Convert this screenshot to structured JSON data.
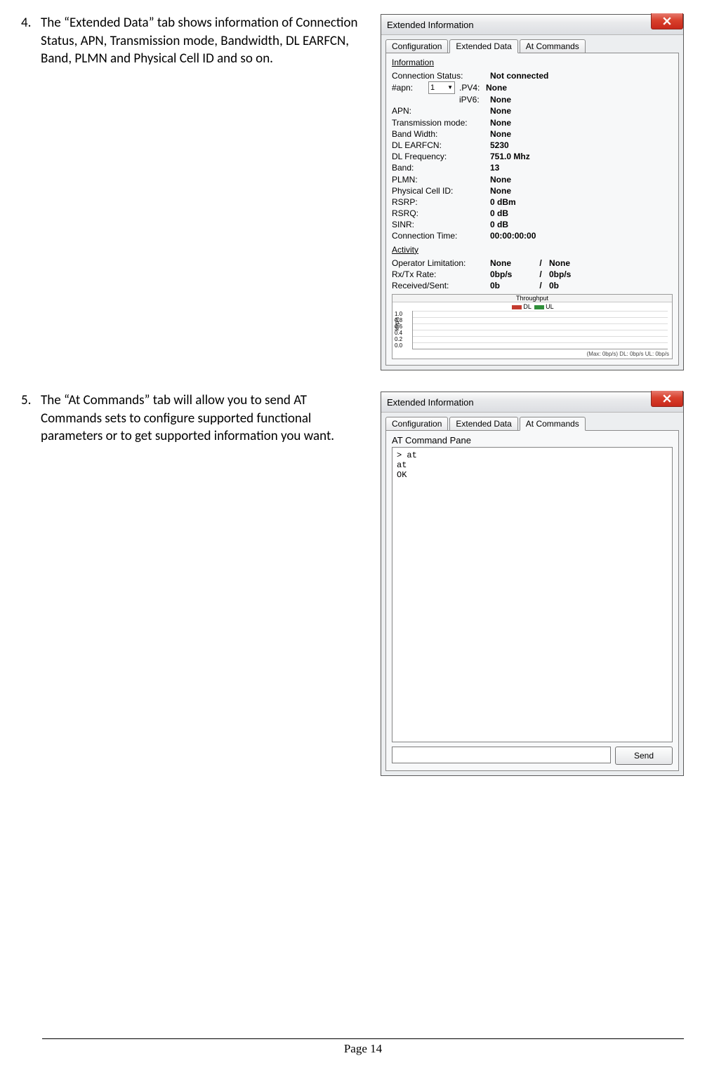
{
  "items": [
    {
      "num": "4.",
      "desc": "The “Extended Data” tab shows information of Connection Status, APN, Transmission mode, Bandwidth, DL EARFCN, Band, PLMN and Physical Cell ID and so on."
    },
    {
      "num": "5.",
      "desc": "The “At Commands” tab will allow you to send AT Commands sets to configure supported functional parameters or to get supported information you want."
    }
  ],
  "win1": {
    "title": "Extended Information",
    "tabs": [
      "Configuration",
      "Extended Data",
      "At Commands"
    ],
    "active_tab": 1,
    "group_info": "Information",
    "info": {
      "conn_status_k": "Connection Status:",
      "conn_status_v": "Not connected",
      "apn_num_k": "#apn:",
      "apn_num_v": "1",
      "pv4_k": ".PV4:",
      "pv4_v": "None",
      "pv6_k": "iPV6:",
      "pv6_v": "None",
      "apn_k": "APN:",
      "apn_v": "None",
      "tx_k": "Transmission mode:",
      "tx_v": "None",
      "bw_k": "Band Width:",
      "bw_v": "None",
      "earfcn_k": "DL EARFCN:",
      "earfcn_v": "5230",
      "dlf_k": "DL Frequency:",
      "dlf_v": "751.0 Mhz",
      "band_k": "Band:",
      "band_v": "13",
      "plmn_k": "PLMN:",
      "plmn_v": "None",
      "pci_k": "Physical Cell ID:",
      "pci_v": "None",
      "rsrp_k": "RSRP:",
      "rsrp_v": "0 dBm",
      "rsrq_k": "RSRQ:",
      "rsrq_v": "0 dB",
      "sinr_k": "SINR:",
      "sinr_v": "0 dB",
      "ct_k": "Connection Time:",
      "ct_v": "00:00:00:00"
    },
    "group_act": "Activity",
    "act": {
      "op_k": "Operator Limitation:",
      "op_a": "None",
      "op_b": "None",
      "rate_k": "Rx/Tx Rate:",
      "rate_a": "0bp/s",
      "rate_b": "0bp/s",
      "rs_k": "Received/Sent:",
      "rs_a": "0b",
      "rs_b": "0b",
      "sep": "/"
    },
    "chart": {
      "title": "Throughput",
      "legend_dl": "DL",
      "legend_ul": "UL",
      "yticks": "1.0\n0.8\n0.6\n0.4\n0.2\n0.0",
      "yunit": "kbp/s",
      "foot": "(Max: 0bp/s) DL: 0bp/s UL: 0bp/s"
    }
  },
  "win2": {
    "title": "Extended Information",
    "tabs": [
      "Configuration",
      "Extended Data",
      "At Commands"
    ],
    "active_tab": 2,
    "pane_title": "AT Command Pane",
    "output": "> at\nat\nOK",
    "input": "",
    "send": "Send"
  },
  "footer": "Page 14",
  "chart_data": {
    "type": "line",
    "title": "Throughput",
    "ylabel": "kbp/s",
    "ylim": [
      0,
      1.0
    ],
    "yticks": [
      0.0,
      0.2,
      0.4,
      0.6,
      0.8,
      1.0
    ],
    "series": [
      {
        "name": "DL",
        "values": [
          0,
          0,
          0,
          0,
          0,
          0,
          0,
          0,
          0,
          0
        ]
      },
      {
        "name": "UL",
        "values": [
          0,
          0,
          0,
          0,
          0,
          0,
          0,
          0,
          0,
          0
        ]
      }
    ],
    "annotation": "(Max: 0bp/s) DL: 0bp/s UL: 0bp/s"
  }
}
